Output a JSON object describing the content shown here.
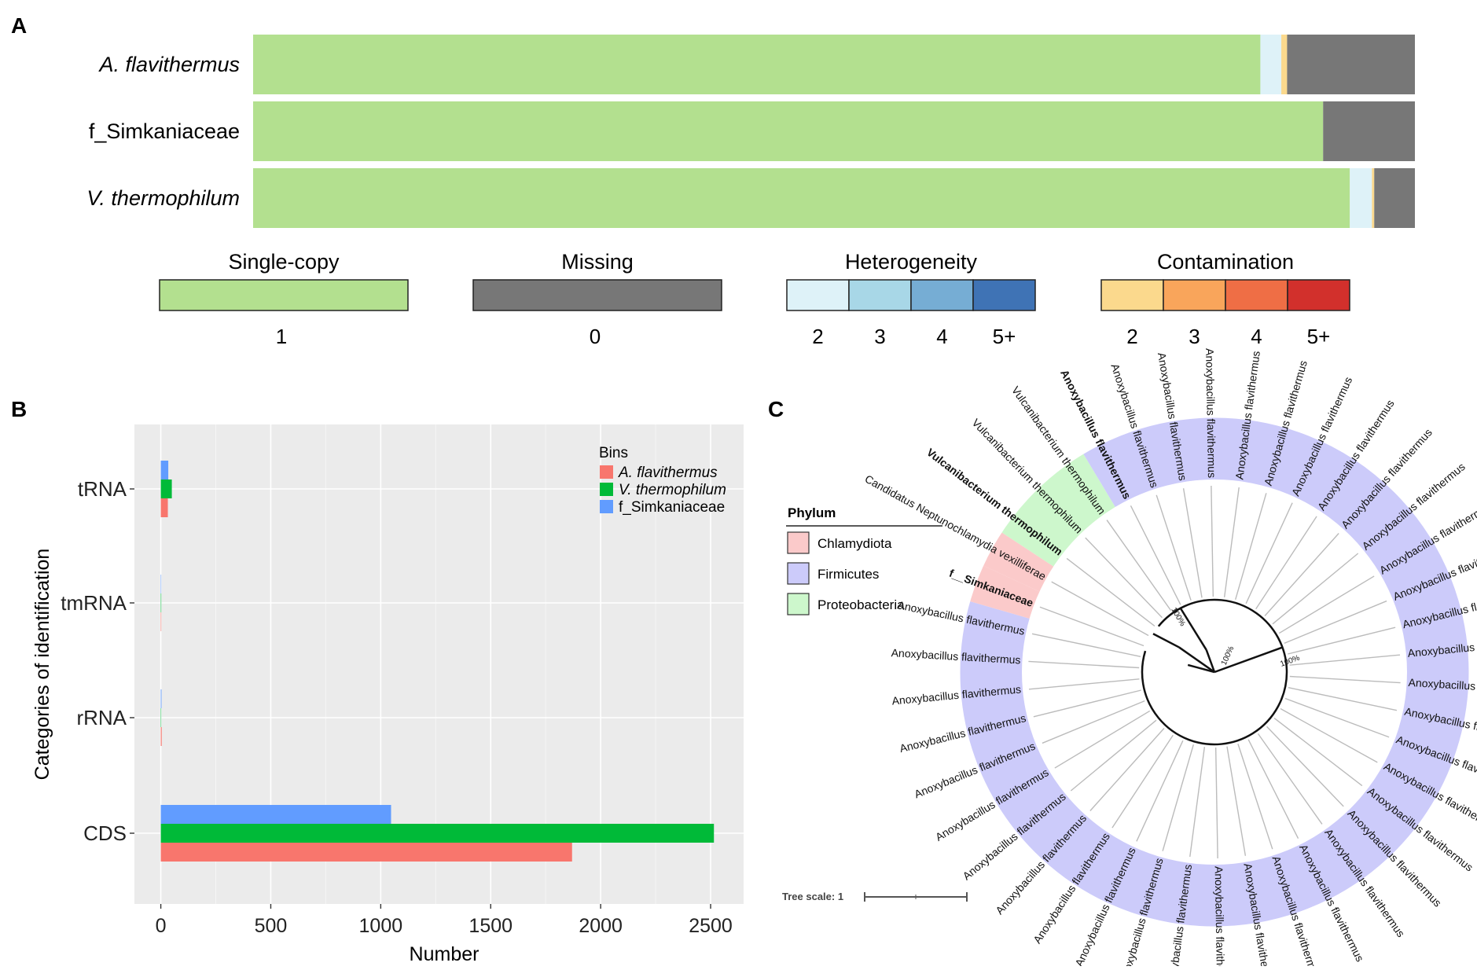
{
  "panels": {
    "a": "A",
    "b": "B",
    "c": "C"
  },
  "chart_data": [
    {
      "type": "bar",
      "orientation": "horizontal-stacked",
      "panel": "A",
      "categories": [
        "A. flavithermus",
        "f_Simkaniaceae",
        "V. thermophilum"
      ],
      "category_italic": [
        true,
        false,
        true
      ],
      "series": [
        {
          "name": "1",
          "group": "Single-copy",
          "color": "#b3e08f",
          "values": [
            86.7,
            92.1,
            94.4
          ]
        },
        {
          "name": "2",
          "group": "Heterogeneity",
          "color": "#def2f8",
          "values": [
            1.8,
            0.0,
            1.9
          ]
        },
        {
          "name": "3",
          "group": "Heterogeneity",
          "color": "#a8d7e7",
          "values": [
            0.0,
            0.0,
            0.0
          ]
        },
        {
          "name": "4",
          "group": "Heterogeneity",
          "color": "#76add4",
          "values": [
            0.0,
            0.0,
            0.0
          ]
        },
        {
          "name": "5+",
          "group": "Heterogeneity",
          "color": "#3f73b5",
          "values": [
            0.0,
            0.0,
            0.0
          ]
        },
        {
          "name": "2",
          "group": "Contamination",
          "color": "#fbd98d",
          "values": [
            0.5,
            0.0,
            0.2
          ]
        },
        {
          "name": "3",
          "group": "Contamination",
          "color": "#f9a55b",
          "values": [
            0.0,
            0.0,
            0.0
          ]
        },
        {
          "name": "4",
          "group": "Contamination",
          "color": "#ef6e45",
          "values": [
            0.0,
            0.0,
            0.0
          ]
        },
        {
          "name": "5+",
          "group": "Contamination",
          "color": "#d2302c",
          "values": [
            0.0,
            0.0,
            0.0
          ]
        },
        {
          "name": "0",
          "group": "Missing",
          "color": "#777777",
          "values": [
            11.0,
            7.9,
            3.5
          ]
        }
      ],
      "legend": [
        {
          "title": "Single-copy",
          "items": [
            {
              "label": "1",
              "color": "#b3e08f"
            }
          ]
        },
        {
          "title": "Missing",
          "items": [
            {
              "label": "0",
              "color": "#777777"
            }
          ]
        },
        {
          "title": "Heterogeneity",
          "items": [
            {
              "label": "2",
              "color": "#def2f8"
            },
            {
              "label": "3",
              "color": "#a8d7e7"
            },
            {
              "label": "4",
              "color": "#76add4"
            },
            {
              "label": "5+",
              "color": "#3f73b5"
            }
          ]
        },
        {
          "title": "Contamination",
          "items": [
            {
              "label": "2",
              "color": "#fbd98d"
            },
            {
              "label": "3",
              "color": "#f9a55b"
            },
            {
              "label": "4",
              "color": "#ef6e45"
            },
            {
              "label": "5+",
              "color": "#d2302c"
            }
          ]
        }
      ]
    },
    {
      "type": "bar",
      "orientation": "horizontal-grouped",
      "panel": "B",
      "categories": [
        "tRNA",
        "tmRNA",
        "rRNA",
        "CDS"
      ],
      "series": [
        {
          "name": "A. flavithermus",
          "italic": true,
          "color": "#f8766d",
          "values": [
            32,
            2,
            4,
            1870
          ]
        },
        {
          "name": "V. thermophilum",
          "italic": true,
          "color": "#00ba38",
          "values": [
            50,
            2,
            0,
            2515
          ]
        },
        {
          "name": "f_Simkaniaceae",
          "italic": false,
          "color": "#619cff",
          "values": [
            34,
            1,
            3,
            1047
          ]
        }
      ],
      "xlabel": "Number",
      "ylabel": "Categories of identification",
      "xlim": [
        -120,
        2650
      ],
      "xticks": [
        0,
        500,
        1000,
        1500,
        2000,
        2500
      ],
      "legend_title": "Bins",
      "legend_position": "top-right",
      "grid": true,
      "panel_background": "#ebebeb"
    },
    {
      "type": "tree",
      "layout": "circular",
      "panel": "C",
      "legend_title": "Phylum",
      "phyla": [
        {
          "name": "Chlamydiota",
          "color": "#fbcaca"
        },
        {
          "name": "Firmicutes",
          "color": "#cccbfa"
        },
        {
          "name": "Proteobacteria",
          "color": "#cdf7cc"
        }
      ],
      "leaves": [
        {
          "label": "Candidatus Neptunochlamydia vexilliferae",
          "phylum": "Chlamydiota",
          "bold": false
        },
        {
          "label": "Vulcanibacterium thermophilum",
          "phylum": "Proteobacteria",
          "bold": true
        },
        {
          "label": "Vulcanibacterium thermophilum",
          "phylum": "Proteobacteria",
          "bold": false
        },
        {
          "label": "Vulcanibacterium thermophilum",
          "phylum": "Proteobacteria",
          "bold": false
        },
        {
          "label": "Anoxybacillus flavithermus",
          "phylum": "Firmicutes",
          "bold": true
        },
        {
          "label": "Anoxybacillus flavithermus",
          "phylum": "Firmicutes",
          "bold": false
        },
        {
          "label": "Anoxybacillus flavithermus",
          "phylum": "Firmicutes",
          "bold": false
        },
        {
          "label": "Anoxybacillus flavithermus",
          "phylum": "Firmicutes",
          "bold": false
        },
        {
          "label": "Anoxybacillus flavithermus",
          "phylum": "Firmicutes",
          "bold": false
        },
        {
          "label": "Anoxybacillus flavithermus",
          "phylum": "Firmicutes",
          "bold": false
        },
        {
          "label": "Anoxybacillus flavithermus",
          "phylum": "Firmicutes",
          "bold": false
        },
        {
          "label": "Anoxybacillus flavithermus",
          "phylum": "Firmicutes",
          "bold": false
        },
        {
          "label": "Anoxybacillus flavithermus",
          "phylum": "Firmicutes",
          "bold": false
        },
        {
          "label": "Anoxybacillus flavithermus",
          "phylum": "Firmicutes",
          "bold": false
        },
        {
          "label": "Anoxybacillus flavithermus",
          "phylum": "Firmicutes",
          "bold": false
        },
        {
          "label": "Anoxybacillus flavithermus",
          "phylum": "Firmicutes",
          "bold": false
        },
        {
          "label": "Anoxybacillus flavithermus",
          "phylum": "Firmicutes",
          "bold": false
        },
        {
          "label": "Anoxybacillus flavithermus",
          "phylum": "Firmicutes",
          "bold": false
        },
        {
          "label": "Anoxybacillus flavithermus",
          "phylum": "Firmicutes",
          "bold": false
        },
        {
          "label": "Anoxybacillus flavithermus",
          "phylum": "Firmicutes",
          "bold": false
        },
        {
          "label": "Anoxybacillus flavithermus",
          "phylum": "Firmicutes",
          "bold": false
        },
        {
          "label": "Anoxybacillus flavithermus",
          "phylum": "Firmicutes",
          "bold": false
        },
        {
          "label": "Anoxybacillus flavithermus",
          "phylum": "Firmicutes",
          "bold": false
        },
        {
          "label": "Anoxybacillus flavithermus",
          "phylum": "Firmicutes",
          "bold": false
        },
        {
          "label": "Anoxybacillus flavithermus",
          "phylum": "Firmicutes",
          "bold": false
        },
        {
          "label": "Anoxybacillus flavithermus",
          "phylum": "Firmicutes",
          "bold": false
        },
        {
          "label": "Anoxybacillus flavithermus",
          "phylum": "Firmicutes",
          "bold": false
        },
        {
          "label": "Anoxybacillus flavithermus",
          "phylum": "Firmicutes",
          "bold": false
        },
        {
          "label": "Anoxybacillus flavithermus",
          "phylum": "Firmicutes",
          "bold": false
        },
        {
          "label": "Anoxybacillus flavithermus",
          "phylum": "Firmicutes",
          "bold": false
        },
        {
          "label": "Anoxybacillus flavithermus",
          "phylum": "Firmicutes",
          "bold": false
        },
        {
          "label": "Anoxybacillus flavithermus",
          "phylum": "Firmicutes",
          "bold": false
        },
        {
          "label": "Anoxybacillus flavithermus",
          "phylum": "Firmicutes",
          "bold": false
        },
        {
          "label": "Anoxybacillus flavithermus",
          "phylum": "Firmicutes",
          "bold": false
        },
        {
          "label": "Anoxybacillus flavithermus",
          "phylum": "Firmicutes",
          "bold": false
        },
        {
          "label": "Anoxybacillus flavithermus",
          "phylum": "Firmicutes",
          "bold": false
        },
        {
          "label": "Anoxybacillus flavithermus",
          "phylum": "Firmicutes",
          "bold": false
        },
        {
          "label": "Anoxybacillus flavithermus",
          "phylum": "Firmicutes",
          "bold": false
        },
        {
          "label": "Anoxybacillus flavithermus",
          "phylum": "Firmicutes",
          "bold": false
        },
        {
          "label": "Anoxybacillus flavithermus",
          "phylum": "Firmicutes",
          "bold": false
        },
        {
          "label": "Anoxybacillus flavithermus",
          "phylum": "Firmicutes",
          "bold": false
        },
        {
          "label": "f__Simkaniaceae",
          "phylum": "Chlamydiota",
          "bold": true
        }
      ],
      "bootstrap_labels": [
        "100%",
        "100%",
        "100%"
      ],
      "tree_scale_label": "Tree scale: 1"
    }
  ]
}
